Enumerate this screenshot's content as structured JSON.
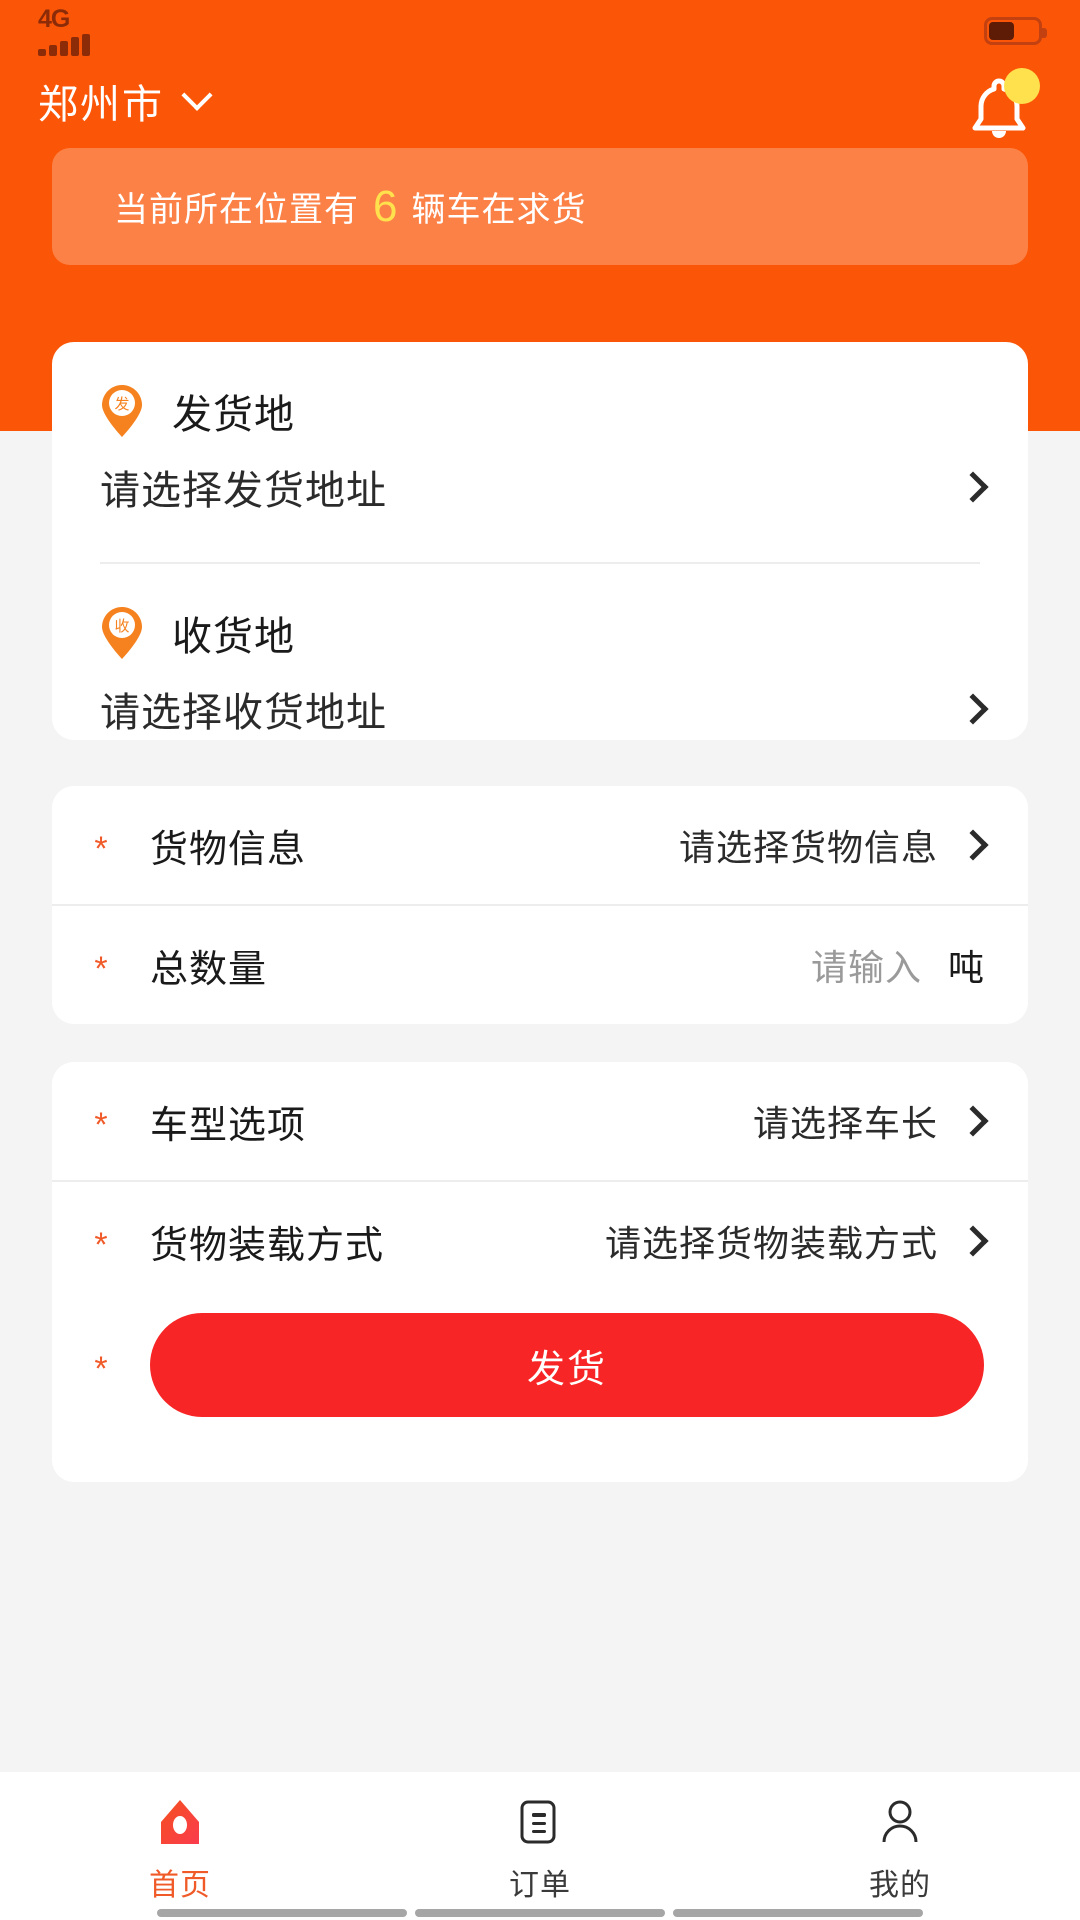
{
  "statusbar": {
    "network": "4G",
    "signal_icon": "signal-bars-icon",
    "battery_icon": "battery-icon"
  },
  "header": {
    "city": "郑州市",
    "city_chevron_icon": "chevron-down-icon",
    "bell_icon": "bell-icon",
    "notice": {
      "prefix": "当前所在位置有",
      "count": "6",
      "suffix": "辆车在求货"
    }
  },
  "address_card": {
    "pickup": {
      "pin_icon": "pin-pickup-icon",
      "pin_char": "发",
      "title": "发货地",
      "value": "请选择发货地址",
      "chevron_icon": "chevron-right-icon"
    },
    "dropoff": {
      "pin_icon": "pin-dropoff-icon",
      "pin_char": "收",
      "title": "收货地",
      "value": "请选择收货地址",
      "chevron_icon": "chevron-right-icon"
    }
  },
  "cargo_card": {
    "rows": [
      {
        "required": "*",
        "label": "货物信息",
        "value": "请选择货物信息",
        "chevron_icon": "chevron-right-icon"
      },
      {
        "required": "*",
        "label": "总数量",
        "placeholder": "请输入",
        "unit": "吨"
      }
    ]
  },
  "vehicle_card": {
    "rows": [
      {
        "required": "*",
        "label": "车型选项",
        "value": "请选择车长",
        "chevron_icon": "chevron-right-icon"
      },
      {
        "required": "*",
        "label": "货物装载方式",
        "value": "请选择货物装载方式",
        "chevron_icon": "chevron-right-icon"
      }
    ],
    "submit": {
      "required": "*",
      "label": "发货"
    }
  },
  "tabbar": {
    "tabs": [
      {
        "icon": "home-icon",
        "label": "首页",
        "active": true
      },
      {
        "icon": "order-icon",
        "label": "订单",
        "active": false
      },
      {
        "icon": "person-icon",
        "label": "我的",
        "active": false
      }
    ]
  },
  "colors": {
    "brand_orange": "#fb5607",
    "accent_orange": "#f05a28",
    "submit_red": "#f72525",
    "badge_yellow": "#ffe14d",
    "placeholder_gray": "#9a9a9a"
  }
}
